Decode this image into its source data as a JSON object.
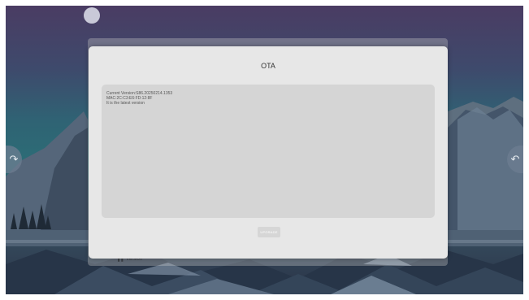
{
  "dialog": {
    "title": "OTA",
    "info_lines": [
      "Current Version:S86.20250214.1353",
      "MAC:2C:C3:E6:FD:12:8F",
      "It is the latest version"
    ],
    "upgrade_label": "UPGRADE"
  },
  "background": {
    "partial_label": "▌▌ Version"
  },
  "icons": {
    "left_button": "redo-arrow-icon",
    "right_button": "undo-arrow-icon"
  },
  "colors": {
    "dialog_bg": "#e7e7e7",
    "info_box_bg": "#d5d5d5",
    "button_bg": "#d6d6d6"
  }
}
